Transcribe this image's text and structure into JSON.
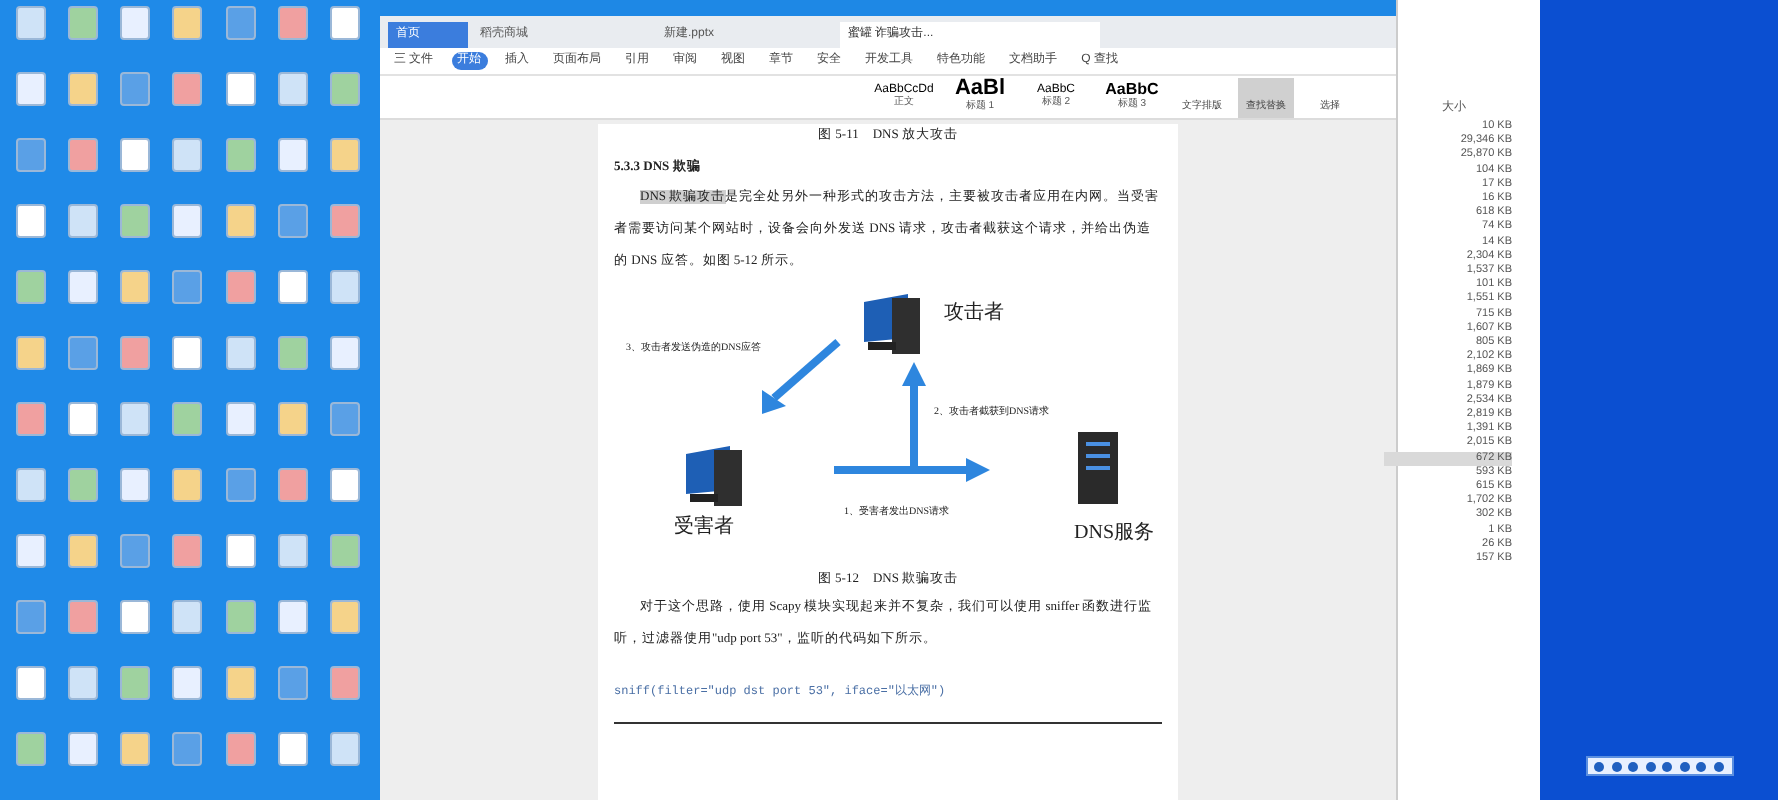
{
  "tabs": [
    {
      "label": "首页",
      "selected": false
    },
    {
      "label": "稻壳商城",
      "selected": false
    },
    {
      "label": "新建.pptx",
      "selected": false
    },
    {
      "label": "蜜罐 诈骗攻击...",
      "selected": true
    }
  ],
  "menu": [
    {
      "label": "三 文件",
      "selected": false
    },
    {
      "label": "开始",
      "selected": true
    },
    {
      "label": "插入",
      "selected": false
    },
    {
      "label": "页面布局",
      "selected": false
    },
    {
      "label": "引用",
      "selected": false
    },
    {
      "label": "审阅",
      "selected": false
    },
    {
      "label": "视图",
      "selected": false
    },
    {
      "label": "章节",
      "selected": false
    },
    {
      "label": "安全",
      "selected": false
    },
    {
      "label": "开发工具",
      "selected": false
    },
    {
      "label": "特色功能",
      "selected": false
    },
    {
      "label": "文档助手",
      "selected": false
    },
    {
      "label": "Q 查找",
      "selected": false
    }
  ],
  "styles": [
    {
      "preview": "AaBbCcDd",
      "label": "正文",
      "kind": "small"
    },
    {
      "preview": "AaBl",
      "label": "标题 1",
      "kind": "big"
    },
    {
      "preview": "AaBbC",
      "label": "标题 2",
      "kind": "small"
    },
    {
      "preview": "AaBbC",
      "label": "标题 3",
      "kind": "medium"
    }
  ],
  "tools": [
    {
      "label": "文字排版",
      "selected": false
    },
    {
      "label": "查找替换",
      "selected": true
    },
    {
      "label": "选择",
      "selected": false
    }
  ],
  "document": {
    "caption_top": "图 5-11　DNS 放大攻击",
    "heading": "5.3.3 DNS 欺骗",
    "para1_highlight": "DNS 欺骗攻击",
    "para1": "是完全处另外一种形式的攻击方法，主要被攻击者应用在内网。当受害者需要访问某个网站时，设备会向外发送 DNS 请求，攻击者截获这个请求，并给出伪造的 DNS 应答。如图 5-12 所示。",
    "diagram": {
      "attacker": "攻击者",
      "victim": "受害者",
      "server": "DNS服务",
      "step3": "3、攻击者发送伪造的DNS应答",
      "step2": "2、攻击者截获到DNS请求",
      "step1": "1、受害者发出DNS请求"
    },
    "caption": "图 5-12　DNS 欺骗攻击",
    "para2": "对于这个思路，使用 Scapy 模块实现起来并不复杂，我们可以使用 sniffer 函数进行监听，过滤器使用\"udp port 53\"，监听的代码如下所示。",
    "code": "sniff(filter=\"udp dst port 53\", iface=\"以太网\")"
  },
  "explorer": {
    "column": "大小",
    "rows": [
      {
        "size": "10 KB",
        "selected": false
      },
      {
        "size": "29,346 KB",
        "selected": false
      },
      {
        "size": "25,870 KB",
        "selected": false
      },
      {
        "size": "104 KB",
        "selected": false
      },
      {
        "size": "17 KB",
        "selected": false
      },
      {
        "size": "16 KB",
        "selected": false
      },
      {
        "size": "618 KB",
        "selected": false
      },
      {
        "size": "74 KB",
        "selected": false
      },
      {
        "size": "14 KB",
        "selected": false
      },
      {
        "size": "2,304 KB",
        "selected": false
      },
      {
        "size": "1,537 KB",
        "selected": false
      },
      {
        "size": "101 KB",
        "selected": false
      },
      {
        "size": "1,551 KB",
        "selected": false
      },
      {
        "size": "715 KB",
        "selected": false
      },
      {
        "size": "1,607 KB",
        "selected": false
      },
      {
        "size": "805 KB",
        "selected": false
      },
      {
        "size": "2,102 KB",
        "selected": false
      },
      {
        "size": "1,869 KB",
        "selected": false
      },
      {
        "size": "1,879 KB",
        "selected": false
      },
      {
        "size": "2,534 KB",
        "selected": false
      },
      {
        "size": "2,819 KB",
        "selected": false
      },
      {
        "size": "1,391 KB",
        "selected": false
      },
      {
        "size": "2,015 KB",
        "selected": false
      },
      {
        "size": "672 KB",
        "selected": true
      },
      {
        "size": "593 KB",
        "selected": false
      },
      {
        "size": "615 KB",
        "selected": false
      },
      {
        "size": "1,702 KB",
        "selected": false
      },
      {
        "size": "302 KB",
        "selected": false
      },
      {
        "size": "1 KB",
        "selected": false
      },
      {
        "size": "26 KB",
        "selected": false
      },
      {
        "size": "157 KB",
        "selected": false
      }
    ]
  }
}
